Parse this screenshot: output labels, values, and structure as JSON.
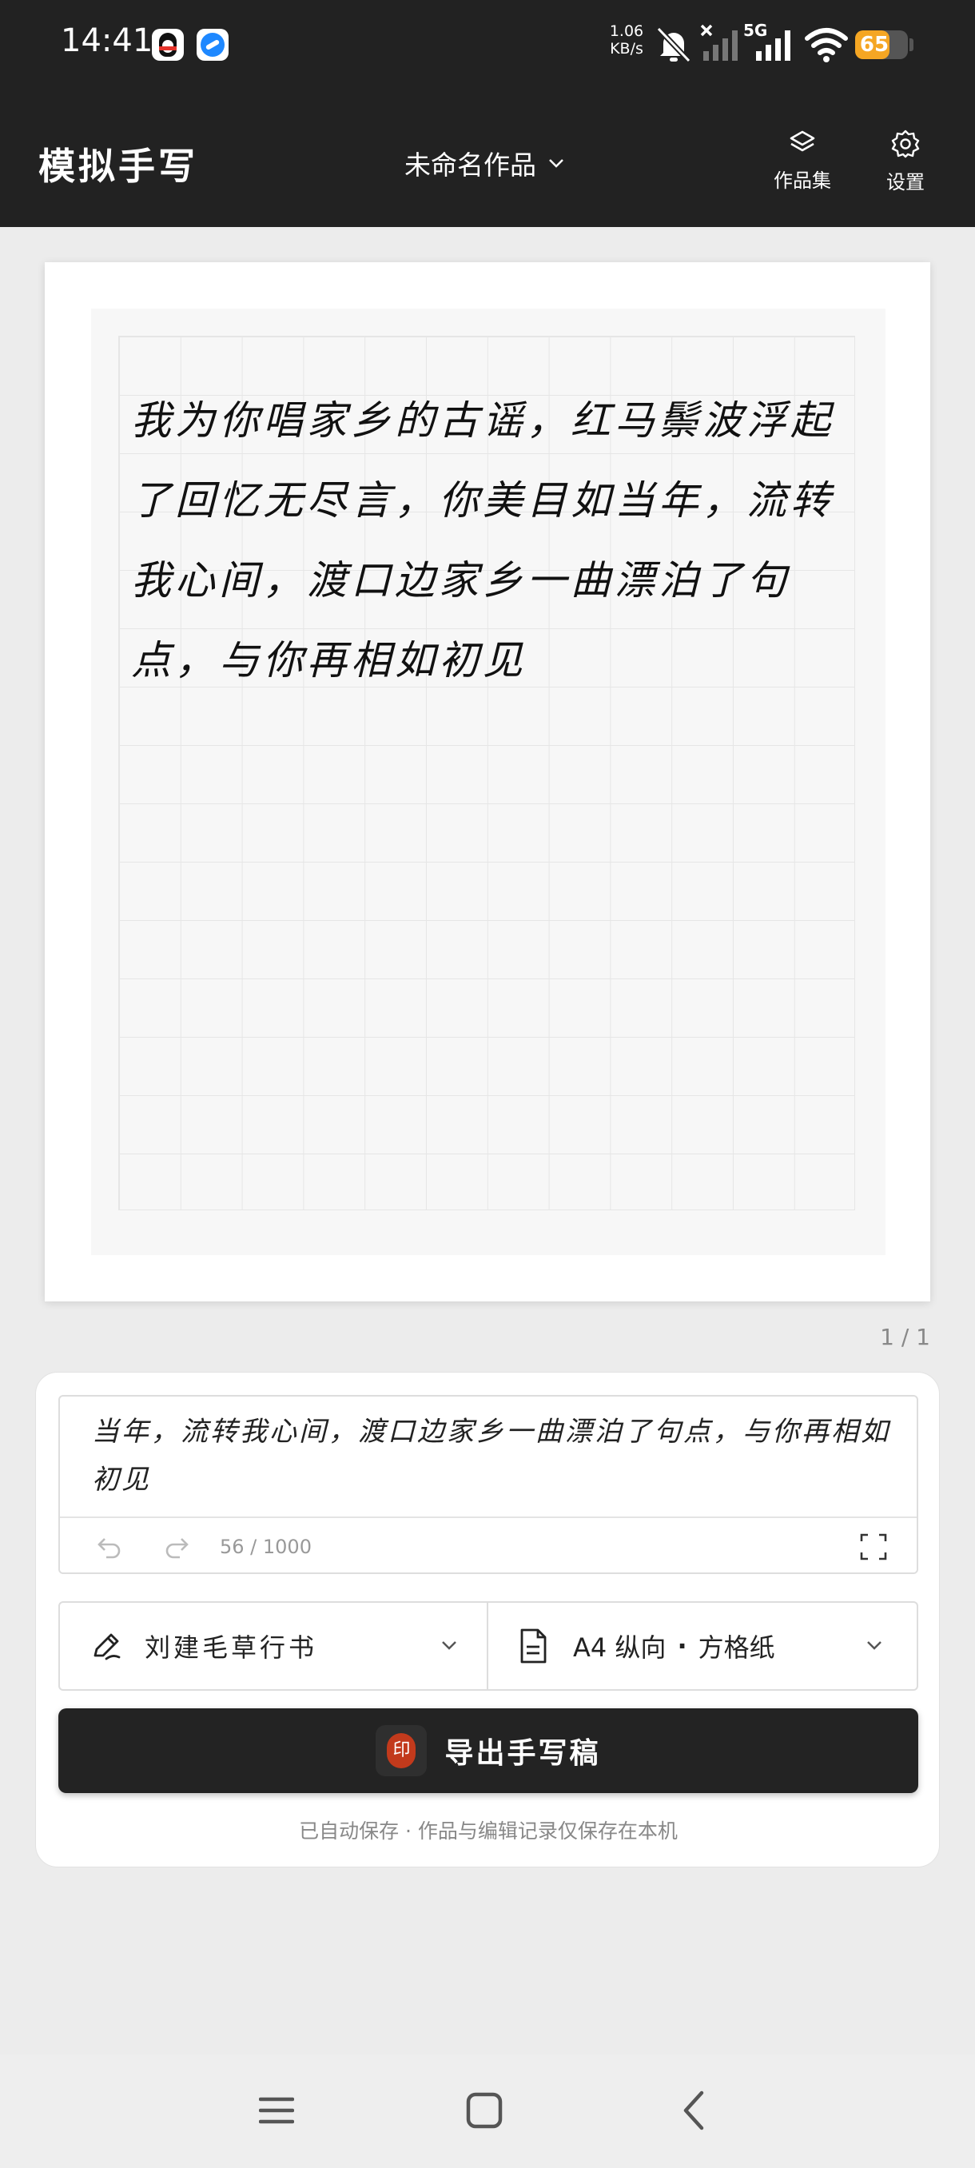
{
  "status_bar": {
    "time": "14:41",
    "notifications": [
      "qq-icon",
      "browser-icon"
    ],
    "net_speed_value": "1.06",
    "net_speed_unit": "KB/s",
    "network_type": "5G",
    "battery": "65",
    "battery_level": 0.65,
    "battery_color": "#f5a623"
  },
  "header": {
    "app_title": "模拟手写",
    "work_title": "未命名作品",
    "collection_label": "作品集",
    "settings_label": "设置"
  },
  "preview": {
    "lines": [
      "我为你唱家乡的古谣，红马鬃波浮起",
      "了回忆无尽言，你美目如当年，流转",
      "我心间，渡口边家乡一曲漂泊了句",
      "点，与你再相如初见"
    ],
    "page_indicator": "1 / 1"
  },
  "editor": {
    "text": "我为你唱家乡的古谣，红马鬃波浮起了回忆无尽言，你美目如当年，流转我心间，渡口边家乡一曲漂泊了句点，与你再相如初见",
    "char_count": "56 / 1000",
    "font_label": "刘建毛草行书",
    "paper_size": "A4 纵向",
    "paper_separator": "·",
    "paper_type": "方格纸",
    "export_seal": "印",
    "export_label": "导出手写稿",
    "save_note": "已自动保存 · 作品与编辑记录仅保存在本机"
  },
  "colors": {
    "header_bg": "#222222",
    "page_bg": "#ececec",
    "export_bg": "#232323",
    "seal_red": "#c23a1c"
  }
}
